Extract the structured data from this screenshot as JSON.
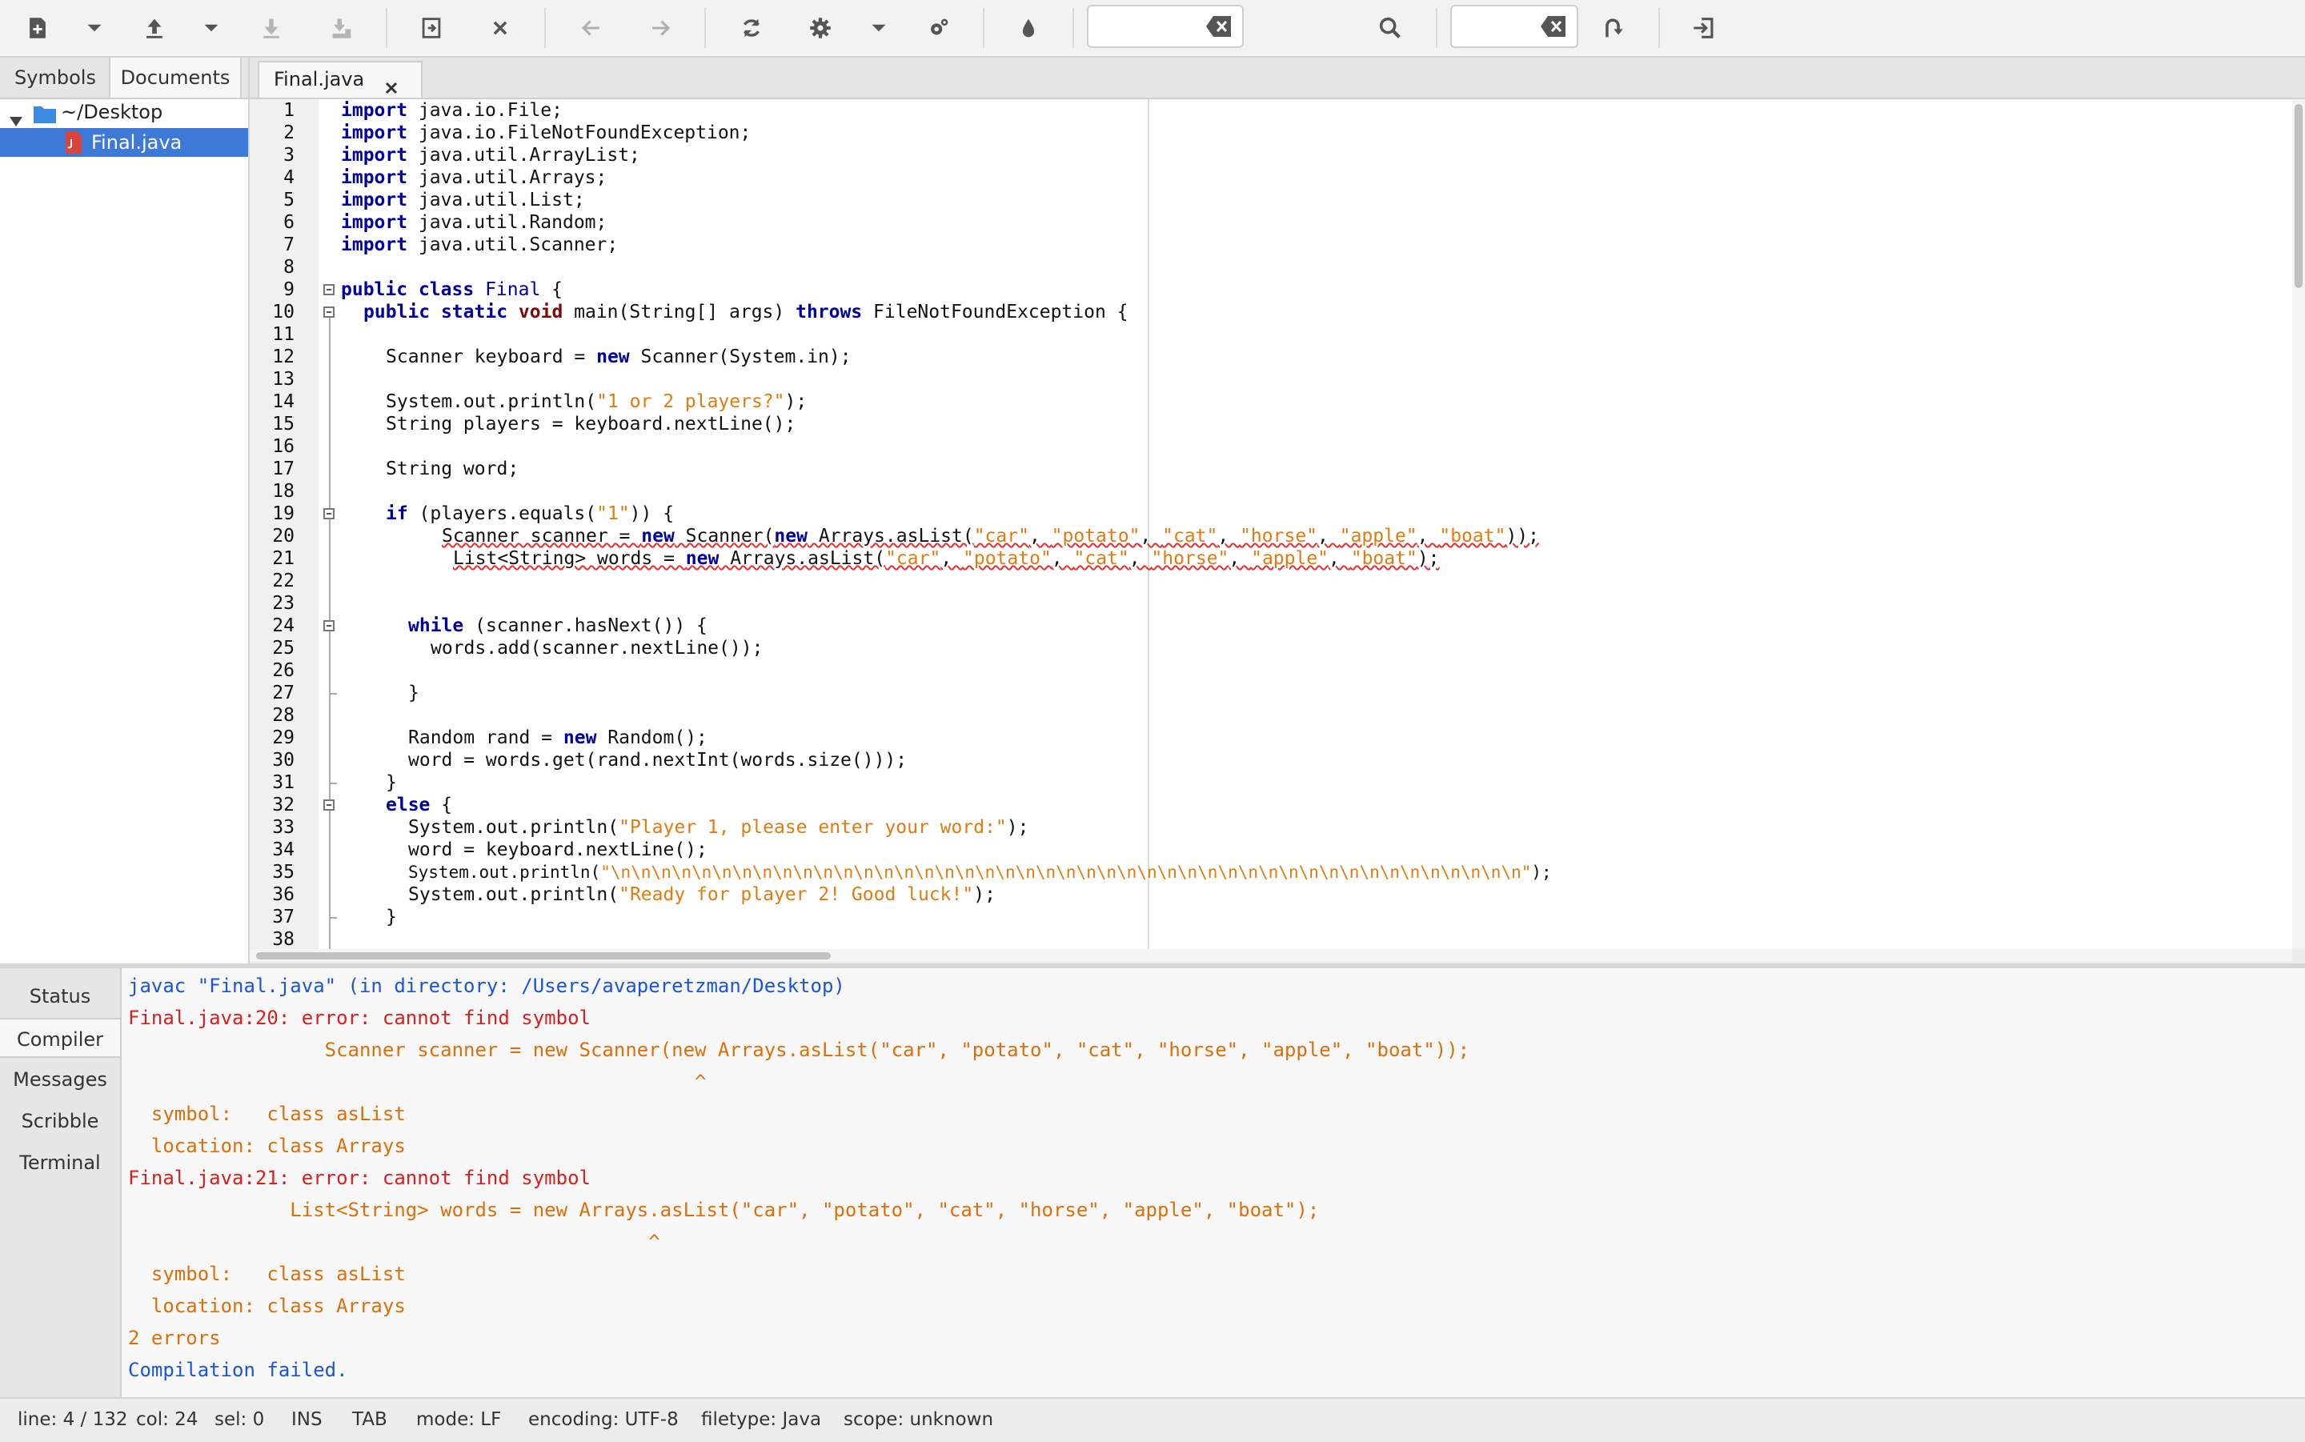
{
  "toolbar": {
    "icons": [
      "new-file-icon",
      "dropdown-icon",
      "open-file-icon",
      "dropdown-icon",
      "save-icon",
      "save-all-icon",
      "revert-icon",
      "close-icon",
      "back-arrow-icon",
      "forward-arrow-icon",
      "reload-icon",
      "build-gear-icon",
      "dropdown-icon",
      "run-gear-icon",
      "color-drop-icon",
      "clear-icon",
      "search-icon",
      "clear-icon",
      "jump-to-line-icon",
      "quit-icon"
    ],
    "search_value": "",
    "goto_value": ""
  },
  "sidebar": {
    "tabs": [
      "Symbols",
      "Documents"
    ],
    "active_tab": "Documents",
    "tree": {
      "folder": "~/Desktop",
      "file": "Final.java"
    }
  },
  "editor": {
    "tab_label": "Final.java",
    "line_numbers": [
      "1",
      "2",
      "3",
      "4",
      "5",
      "6",
      "7",
      "8",
      "9",
      "10",
      "11",
      "12",
      "13",
      "14",
      "15",
      "16",
      "17",
      "18",
      "19",
      "20",
      "21",
      "22",
      "23",
      "24",
      "25",
      "26",
      "27",
      "28",
      "29",
      "30",
      "31",
      "32",
      "33",
      "34",
      "35",
      "36",
      "37",
      "38"
    ],
    "code": {
      "l1": "java.io.File;",
      "l2": "java.io.FileNotFoundException;",
      "l3": "java.util.ArrayList;",
      "l4": "java.util.Arrays;",
      "l5": "java.util.List;",
      "l6": "java.util.Random;",
      "l7": "java.util.Scanner;",
      "kw_import": "import",
      "kw_public": "public",
      "kw_class": "class",
      "kw_static": "static",
      "kw_void": "void",
      "kw_throws": "throws",
      "kw_new": "new",
      "kw_if": "if",
      "kw_while": "while",
      "kw_else": "else",
      "class_name": "Final",
      "l9_end": " {",
      "l10_main": " main(String[] args) ",
      "l10_end": " FileNotFoundException {",
      "l12_a": "Scanner keyboard = ",
      "l12_b": " Scanner(System.in);",
      "l14_a": "System.out.println(",
      "l14_str": "\"1 or 2 players?\"",
      "l14_b": ");",
      "l15": "String players = keyboard.nextLine();",
      "l17": "String word;",
      "l19_a": " (players.equals(",
      "l19_str": "\"1\"",
      "l19_b": ")) {",
      "l20_a": "Scanner scanner = ",
      "l20_b": " Scanner(",
      "l20_c": " Arrays.asList(",
      "list_args": [
        "\"car\"",
        "\"potato\"",
        "\"cat\"",
        "\"horse\"",
        "\"apple\"",
        "\"boat\""
      ],
      "comma": ", ",
      "l20_end": "));",
      "l21_a": "List<String> words = ",
      "l21_b": " Arrays.asList(",
      "l21_end": ");",
      "l24_b": " (scanner.hasNext()) {",
      "l25": "words.add(scanner.nextLine());",
      "brace_close": "}",
      "l29_a": "Random rand = ",
      "l29_b": " Random();",
      "l30": "word = words.get(rand.nextInt(words.size()));",
      "l32_b": " {",
      "l33_a": "System.out.println(",
      "l33_str": "\"Player 1, please enter your word:\"",
      "l33_b": ");",
      "l34": "word = keyboard.nextLine();",
      "l35_a": "System.out.println(",
      "l35_str": "\"\\n\\n\\n\\n\\n\\n\\n\\n\\n\\n\\n\\n\\n\\n\\n\\n\\n\\n\\n\\n\\n\\n\\n\\n\\n\\n\\n\\n\\n\\n\\n\\n\\n\\n\\n\\n\\n\\n\\n\\n\\n\\n\\n\\n\\n\"",
      "l35_b": ");",
      "l36_a": "System.out.println(",
      "l36_str": "\"Ready for player 2! Good luck!\"",
      "l36_b": ");"
    }
  },
  "bottom_panel": {
    "tabs": [
      "Status",
      "Compiler",
      "Messages",
      "Scribble",
      "Terminal"
    ],
    "active_tab": "Compiler",
    "compiler_lines": [
      "javac \"Final.java\" (in directory: /Users/avaperetzman/Desktop)",
      "Final.java:20: error: cannot find symbol",
      "                 Scanner scanner = new Scanner(new Arrays.asList(\"car\", \"potato\", \"cat\", \"horse\", \"apple\", \"boat\"));",
      "                                                 ^",
      "  symbol:   class asList",
      "  location: class Arrays",
      "Final.java:21: error: cannot find symbol",
      "              List<String> words = new Arrays.asList(\"car\", \"potato\", \"cat\", \"horse\", \"apple\", \"boat\");",
      "                                             ^",
      "  symbol:   class asList",
      "  location: class Arrays",
      "2 errors",
      "Compilation failed."
    ],
    "colors": {
      "info": "#1a55d6",
      "error": "#d42020",
      "detail": "#d9700c"
    }
  },
  "statusbar": {
    "line": "line: 4 / 132",
    "col": "col: 24",
    "sel": "sel: 0",
    "ins": "INS",
    "tab": "TAB",
    "mode": "mode: LF",
    "encoding": "encoding: UTF-8",
    "filetype": "filetype: Java",
    "scope": "scope: unknown"
  }
}
